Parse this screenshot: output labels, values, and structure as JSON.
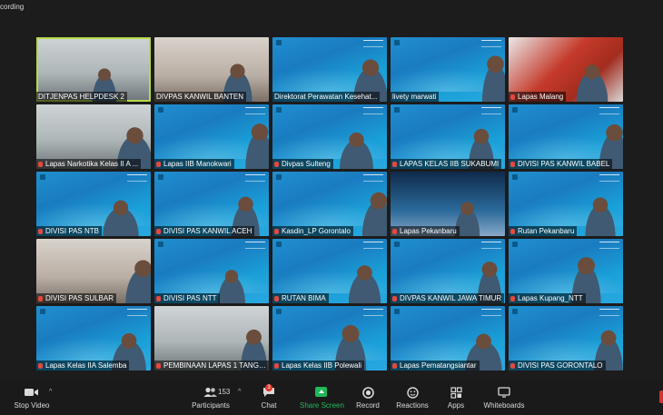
{
  "window": {
    "recording_label": "cording"
  },
  "tiles": [
    {
      "name": "DITJENPAS HELPDESK 2",
      "muted": false,
      "active": true,
      "style": "room"
    },
    {
      "name": "DIVPAS KANWIL BANTEN",
      "muted": false,
      "active": false,
      "style": "room2"
    },
    {
      "name": "Direktorat Perawatan Kesehat...",
      "muted": false,
      "active": false,
      "style": "blue"
    },
    {
      "name": "livety marwati",
      "muted": false,
      "active": false,
      "style": "blue"
    },
    {
      "name": "Lapas Malang",
      "muted": true,
      "active": false,
      "style": "red"
    },
    {
      "name": "Lapas Narkotika Kelas II A ...",
      "muted": true,
      "active": false,
      "style": "room"
    },
    {
      "name": "Lapas IIB Manokwari",
      "muted": true,
      "active": false,
      "style": "blue"
    },
    {
      "name": "Divpas Sulteng",
      "muted": true,
      "active": false,
      "style": "blue"
    },
    {
      "name": "LAPAS KELAS IIB SUKABUMI",
      "muted": true,
      "active": false,
      "style": "blue"
    },
    {
      "name": "DIVISI PAS KANWIL BABEL",
      "muted": true,
      "active": false,
      "style": "blue"
    },
    {
      "name": "DIVISI PAS NTB",
      "muted": true,
      "active": false,
      "style": "blue"
    },
    {
      "name": "DIVISI PAS KANWIL ACEH",
      "muted": true,
      "active": false,
      "style": "blue"
    },
    {
      "name": "Kasdin_LP Gorontalo",
      "muted": true,
      "active": false,
      "style": "blue"
    },
    {
      "name": "Lapas Pekanbaru",
      "muted": true,
      "active": false,
      "style": "dark"
    },
    {
      "name": "Rutan Pekanbaru",
      "muted": true,
      "active": false,
      "style": "blue"
    },
    {
      "name": "DIVISI PAS SULBAR",
      "muted": true,
      "active": false,
      "style": "room2"
    },
    {
      "name": "DIVISI PAS NTT",
      "muted": true,
      "active": false,
      "style": "blue"
    },
    {
      "name": "RUTAN BIMA",
      "muted": true,
      "active": false,
      "style": "blue"
    },
    {
      "name": "DIVPAS KANWIL JAWA TIMUR",
      "muted": true,
      "active": false,
      "style": "blue"
    },
    {
      "name": "Lapas Kupang_NTT",
      "muted": true,
      "active": false,
      "style": "blue"
    },
    {
      "name": "Lapas Kelas IIA Salemba",
      "muted": true,
      "active": false,
      "style": "blue"
    },
    {
      "name": "PEMBINAAN LAPAS 1 TANGE...",
      "muted": true,
      "active": false,
      "style": "room"
    },
    {
      "name": "Lapas Kelas IIB Polewali",
      "muted": true,
      "active": false,
      "style": "blue"
    },
    {
      "name": "Lapas Pematangsiantar",
      "muted": true,
      "active": false,
      "style": "blue"
    },
    {
      "name": "DIVISI PAS GORONTALO",
      "muted": true,
      "active": false,
      "style": "blue"
    }
  ],
  "toolbar": {
    "stop_video": "Stop Video",
    "participants": "Participants",
    "participants_count": "153",
    "chat": "Chat",
    "chat_badge": "3",
    "share_screen": "Share Screen",
    "record": "Record",
    "reactions": "Reactions",
    "apps": "Apps",
    "whiteboards": "Whiteboards"
  },
  "icons": {
    "video": "video-camera-icon",
    "participants": "people-icon",
    "chat": "chat-bubble-icon",
    "share": "share-screen-icon",
    "record": "record-icon",
    "reactions": "emoji-icon",
    "apps": "apps-icon",
    "whiteboards": "whiteboard-icon"
  },
  "colors": {
    "share_green": "#1fb85a",
    "active_speaker": "#b7d94a",
    "muted_red": "#e5483c",
    "tile_blue": "#1a7cc0"
  }
}
